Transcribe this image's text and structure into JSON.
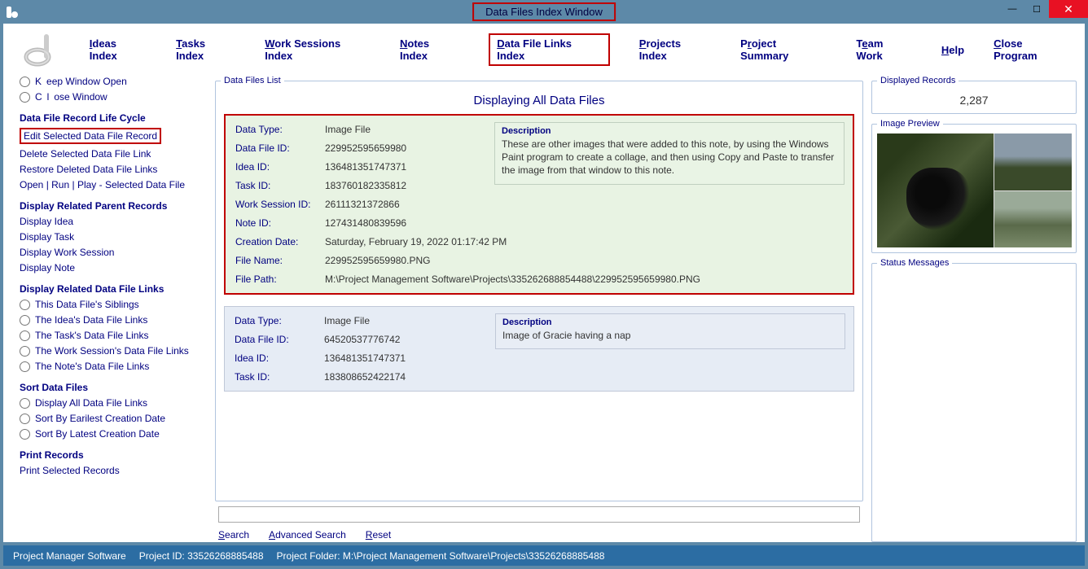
{
  "window": {
    "title": "Data Files Index Window"
  },
  "toolbar": {
    "ideas": "Ideas Index",
    "tasks": "Tasks Index",
    "work_sessions": "Work Sessions Index",
    "notes": "Notes Index",
    "data_file_links": "Data File Links Index",
    "projects": "Projects Index",
    "project_summary": "Project Summary",
    "team_work": "Team Work",
    "help": "Help",
    "close_program": "Close Program"
  },
  "left": {
    "keep_open": "Keep Window Open",
    "close_window": "Close Window",
    "lifecycle_head": "Data File Record Life Cycle",
    "edit_record": "Edit Selected Data File Record",
    "delete_link": "Delete Selected Data File Link",
    "restore_links": "Restore Deleted Data File Links",
    "open_run": "Open | Run | Play - Selected Data File",
    "parent_head": "Display Related Parent Records",
    "display_idea": "Display Idea",
    "display_task": "Display Task",
    "display_ws": "Display Work Session",
    "display_note": "Display Note",
    "dflinks_head": "Display Related Data File Links",
    "siblings": "This Data File's Siblings",
    "idea_links": "The Idea's Data File Links",
    "task_links": "The Task's Data File Links",
    "ws_links": "The Work Session's Data File Links",
    "note_links": "The Note's Data File Links",
    "sort_head": "Sort Data Files",
    "sort_all": "Display All Data File Links",
    "sort_earliest": "Sort By Earilest Creation Date",
    "sort_latest": "Sort By Latest Creation Date",
    "print_head": "Print Records",
    "print_selected": "Print Selected Records"
  },
  "center": {
    "legend": "Data Files List",
    "header": "Displaying All Data Files",
    "records": [
      {
        "data_type": "Image File",
        "data_file_id": "229952595659980",
        "idea_id": "136481351747371",
        "task_id": "183760182335812",
        "work_session_id": "26111321372866",
        "note_id": "127431480839596",
        "creation_date": "Saturday, February 19, 2022   01:17:42 PM",
        "file_name": "229952595659980.PNG",
        "file_path": "M:\\Project Management Software\\Projects\\335262688854488\\229952595659980.PNG",
        "description": "These are other images that were added to this note, by using the Windows Paint program to create a collage, and then using Copy and Paste to transfer the image from that window to this note."
      },
      {
        "data_type": "Image File",
        "data_file_id": "64520537776742",
        "idea_id": "136481351747371",
        "task_id": "183808652422174",
        "description": "Image of Gracie having a nap"
      }
    ],
    "labels": {
      "data_type": "Data Type:",
      "data_file_id": "Data File ID:",
      "idea_id": "Idea ID:",
      "task_id": "Task ID:",
      "work_session_id": "Work Session ID:",
      "note_id": "Note ID:",
      "creation_date": "Creation Date:",
      "file_name": "File Name:",
      "file_path": "File Path:",
      "description": "Description"
    },
    "search": "Search",
    "advanced_search": "Advanced Search",
    "reset": "Reset"
  },
  "right": {
    "displayed_legend": "Displayed Records",
    "displayed_count": "2,287",
    "preview_legend": "Image Preview",
    "status_legend": "Status Messages"
  },
  "statusbar": {
    "app": "Project Manager Software",
    "project_id_label": "Project ID:",
    "project_id": "33526268885488",
    "project_folder_label": "Project Folder:",
    "project_folder": "M:\\Project Management Software\\Projects\\33526268885488"
  }
}
